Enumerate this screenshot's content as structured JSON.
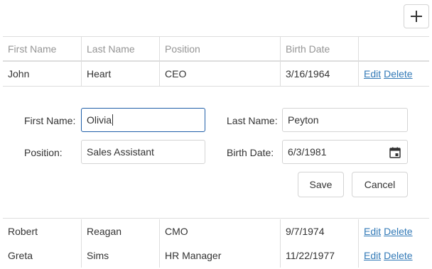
{
  "toolbar": {
    "add_icon": "plus-icon"
  },
  "columns": [
    "First Name",
    "Last Name",
    "Position",
    "Birth Date",
    ""
  ],
  "rows_top": [
    {
      "first": "John",
      "last": "Heart",
      "position": "CEO",
      "birth": "3/16/1964",
      "edit": "Edit",
      "delete": "Delete"
    }
  ],
  "edit_form": {
    "first_name_label": "First Name:",
    "first_name_value": "Olivia",
    "last_name_label": "Last Name:",
    "last_name_value": "Peyton",
    "position_label": "Position:",
    "position_value": "Sales Assistant",
    "birth_date_label": "Birth Date:",
    "birth_date_value": "6/3/1981",
    "calendar_icon": "calendar-icon",
    "save_label": "Save",
    "cancel_label": "Cancel"
  },
  "rows_bottom": [
    {
      "first": "Robert",
      "last": "Reagan",
      "position": "CMO",
      "birth": "9/7/1974",
      "edit": "Edit",
      "delete": "Delete"
    },
    {
      "first": "Greta",
      "last": "Sims",
      "position": "HR Manager",
      "birth": "11/22/1977",
      "edit": "Edit",
      "delete": "Delete"
    }
  ],
  "colors": {
    "link": "#337ab7",
    "focus_border": "#1f5ea8",
    "grid_line": "#dddddd",
    "header_text": "#959595"
  }
}
